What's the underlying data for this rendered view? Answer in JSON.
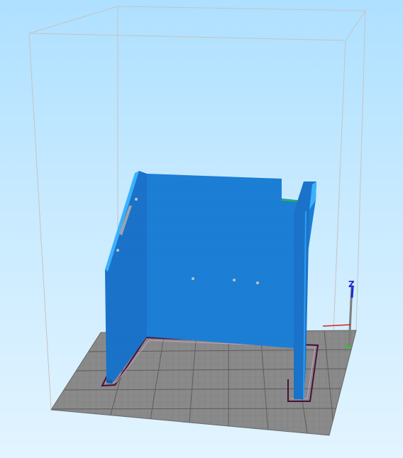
{
  "viewport": {
    "view": "3D preview",
    "background_top": "#aee0ff",
    "background_bottom": "#e2f4ff"
  },
  "build_volume": {
    "frame_color": "#c4c4c4"
  },
  "build_plate": {
    "color": "#8a8a8a",
    "grid_color": "#6a6a6a"
  },
  "model": {
    "color": "#1c7fd6",
    "shade_color": "#1a6fc0",
    "edge_color": "#3bb0ff",
    "outline_color": "#4a0f3a"
  },
  "axes": {
    "z_label": "Z",
    "z_color": "#1b2bd6",
    "y_color": "#22cc22",
    "x_color": "#d62020"
  }
}
